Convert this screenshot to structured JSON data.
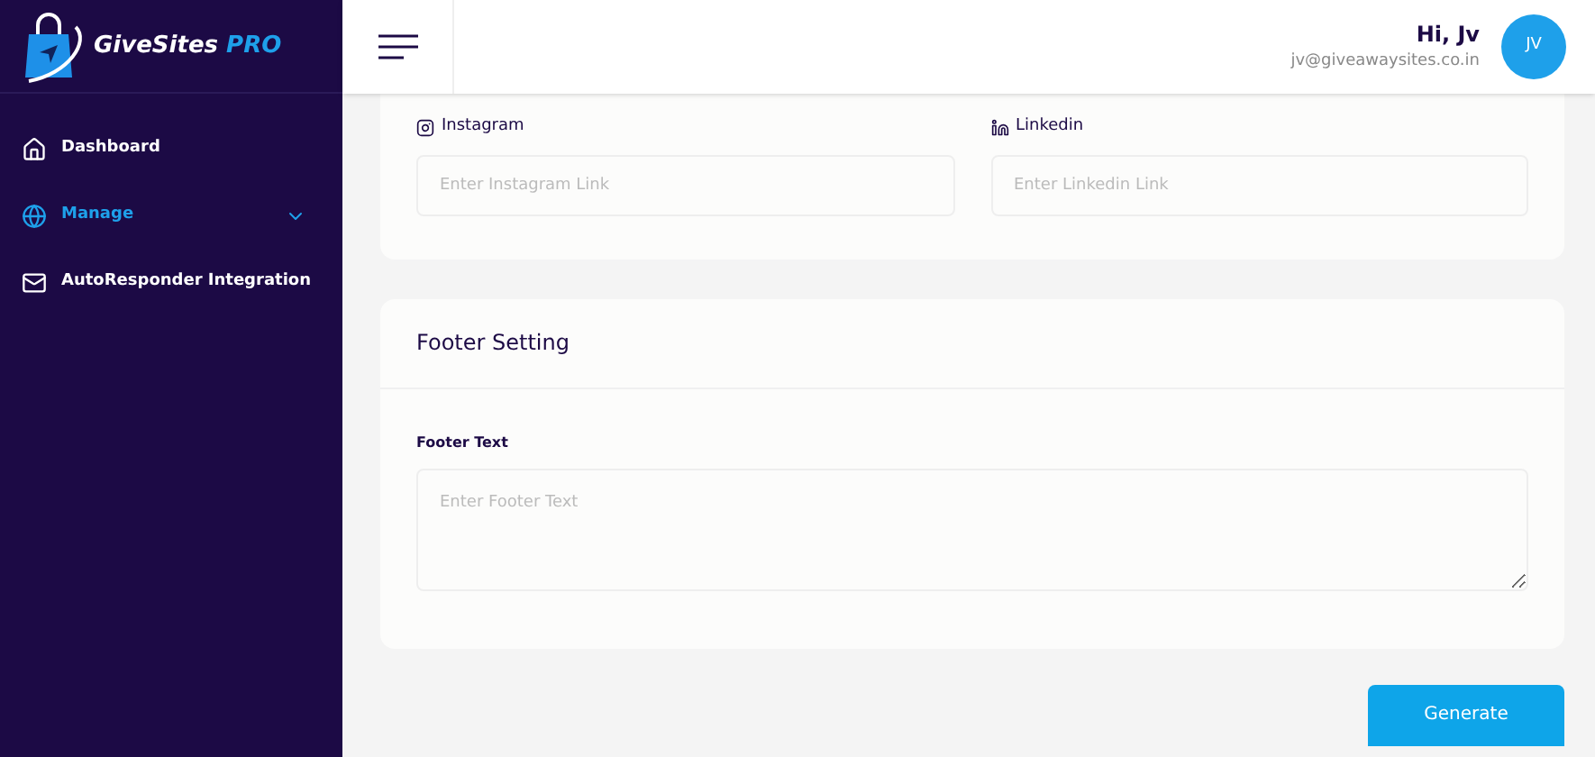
{
  "brand": {
    "name": "GiveSites",
    "suffix": "PRO"
  },
  "sidebar": {
    "items": [
      {
        "label": "Dashboard",
        "selected": false,
        "kind": "link"
      },
      {
        "label": "Manage",
        "selected": true,
        "kind": "group"
      },
      {
        "label": "AutoResponder Integration",
        "selected": false,
        "kind": "link"
      }
    ]
  },
  "header": {
    "greeting": "Hi, Jv",
    "email": "jv@giveawaysites.co.in",
    "avatar": "JV"
  },
  "social_card": {
    "fields": [
      {
        "label": "Instagram",
        "placeholder": "Enter Instagram Link"
      },
      {
        "label": "Linkedin",
        "placeholder": "Enter Linkedin Link"
      }
    ]
  },
  "footer_card": {
    "title": "Footer Setting",
    "field_label": "Footer Text",
    "placeholder": "Enter Footer Text"
  },
  "generate_button": "Generate"
}
